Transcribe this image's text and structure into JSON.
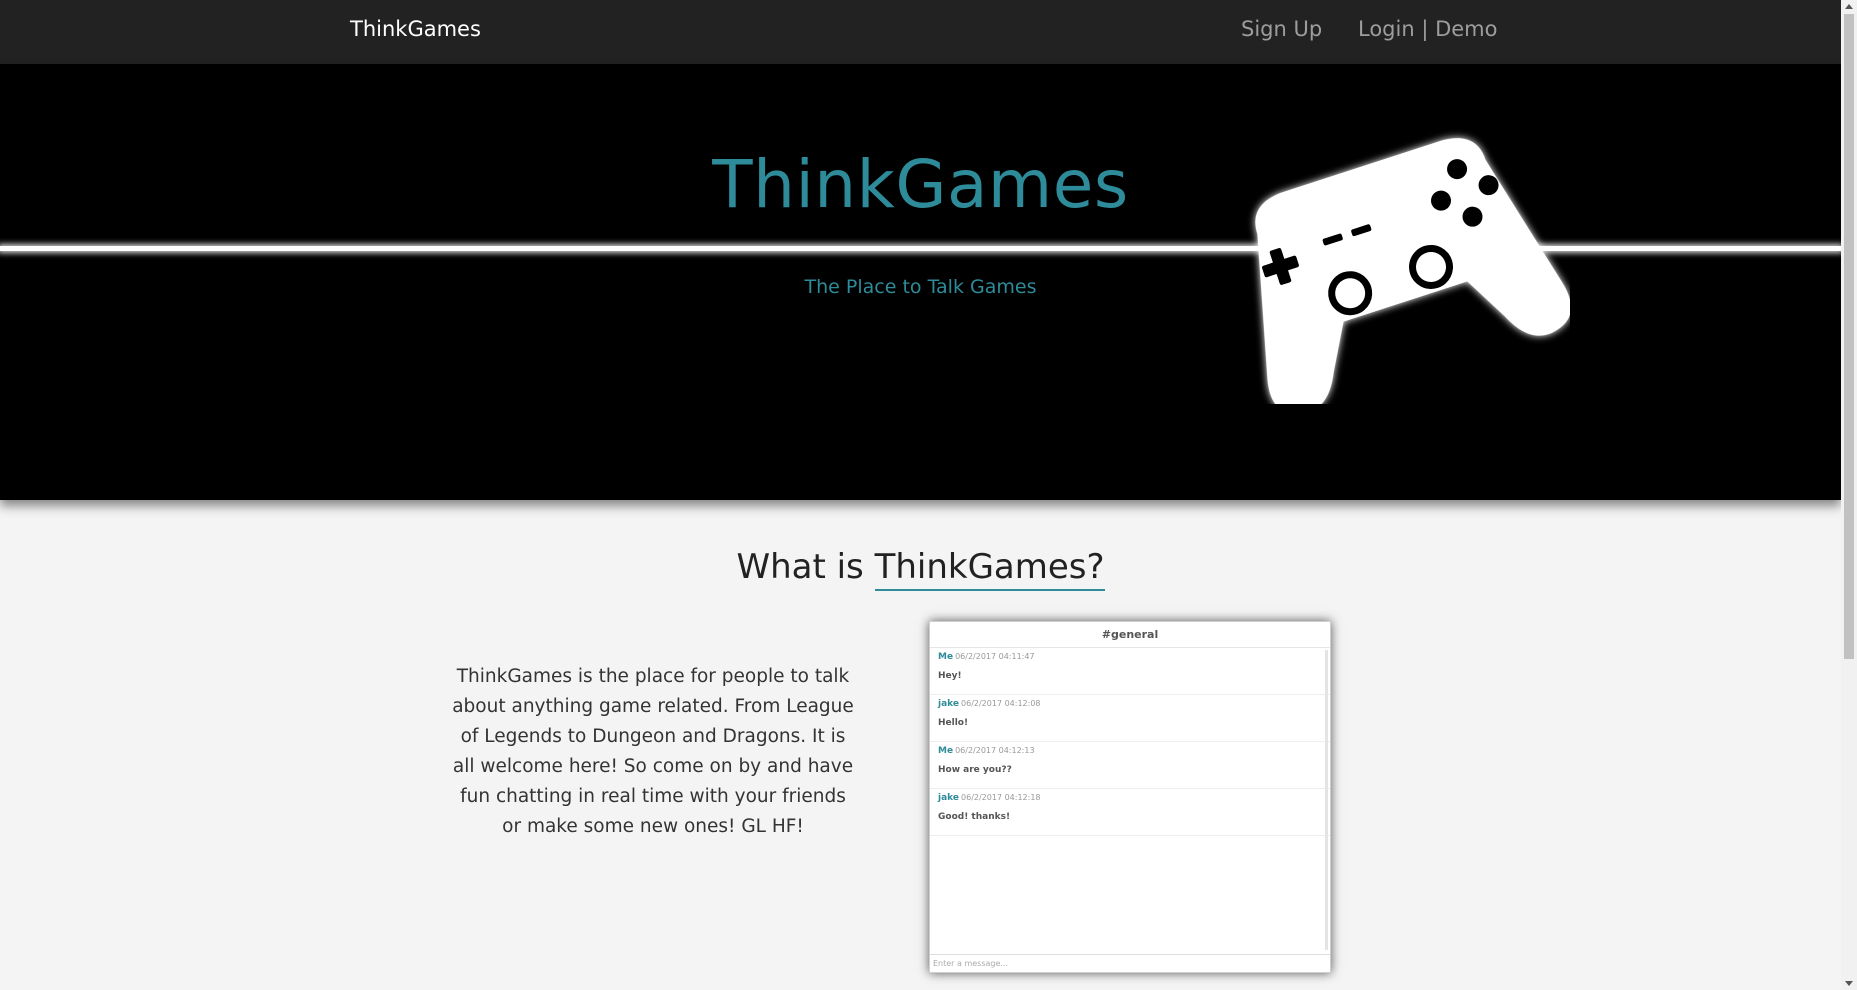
{
  "navbar": {
    "brand": "ThinkGames",
    "sign_up": "Sign Up",
    "login_demo": "Login | Demo"
  },
  "hero": {
    "title": "ThinkGames",
    "subtitle": "The Place to Talk Games",
    "icon": "gamepad-icon"
  },
  "about": {
    "title_prefix": "What is ",
    "title_highlight": "ThinkGames?",
    "description": "ThinkGames is the place for people to talk about anything game related. From League of Legends to Dungeon and Dragons. It is all welcome here! So come on by and have fun chatting in real time with your friends or make some new ones! GL HF!"
  },
  "chat_preview": {
    "channel": "#general",
    "messages": [
      {
        "user": "Me",
        "timestamp": "06/2/2017 04:11:47",
        "text": "Hey!"
      },
      {
        "user": "jake",
        "timestamp": "06/2/2017 04:12:08",
        "text": "Hello!"
      },
      {
        "user": "Me",
        "timestamp": "06/2/2017 04:12:13",
        "text": "How are you??"
      },
      {
        "user": "jake",
        "timestamp": "06/2/2017 04:12:18",
        "text": "Good! thanks!"
      }
    ],
    "input_placeholder": "Enter a message..."
  },
  "colors": {
    "accent": "#2e8b99",
    "navbar_bg": "#222222",
    "hero_bg": "#000000",
    "page_bg": "#f4f4f4"
  }
}
